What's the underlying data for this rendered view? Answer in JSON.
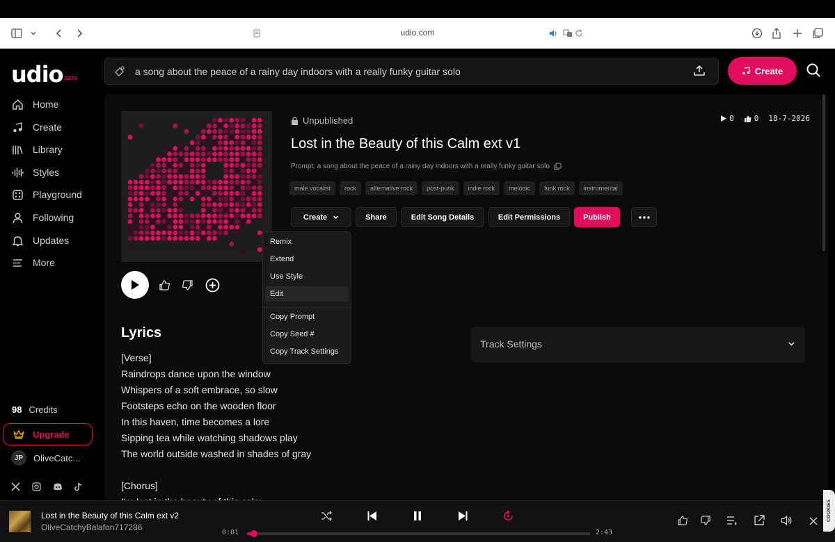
{
  "browser": {
    "url": "udio.com"
  },
  "brand": {
    "name": "udio",
    "badge": "BETA",
    "accent": "#e30b5c"
  },
  "search": {
    "value": "a song about the peace of a rainy day indoors with a really funky guitar solo"
  },
  "header": {
    "create_label": "Create"
  },
  "sidebar": {
    "items": [
      {
        "label": "Home",
        "icon": "home-icon"
      },
      {
        "label": "Create",
        "icon": "music-note-icon"
      },
      {
        "label": "Library",
        "icon": "library-icon"
      },
      {
        "label": "Styles",
        "icon": "waveform-icon"
      },
      {
        "label": "Playground",
        "icon": "playground-icon"
      },
      {
        "label": "Following",
        "icon": "user-icon"
      },
      {
        "label": "Updates",
        "icon": "bell-icon"
      },
      {
        "label": "More",
        "icon": "menu-icon"
      }
    ],
    "credits_count": "98",
    "credits_label": "Credits",
    "upgrade_label": "Upgrade",
    "user_initials": "JP",
    "user_name": "OliveCatc..."
  },
  "song": {
    "status": "Unpublished",
    "plays": "0",
    "likes": "0",
    "date": "18-7-2026",
    "title": "Lost in the Beauty of this Calm ext v1",
    "prompt": "Prompt: a song about the peace of a rainy day indoors with a really funky guitar solo",
    "tags": [
      "male vocalist",
      "rock",
      "alternative rock",
      "post-punk",
      "indie rock",
      "melodic",
      "funk rock",
      "instrumental"
    ]
  },
  "actions": {
    "create": "Create",
    "share": "Share",
    "edit_details": "Edit Song Details",
    "edit_permissions": "Edit Permissions",
    "publish": "Publish"
  },
  "dropdown": {
    "items": [
      "Remix",
      "Extend",
      "Use Style",
      "Edit",
      "Copy Prompt",
      "Copy Seed #",
      "Copy Track Settings"
    ]
  },
  "lyrics": {
    "heading": "Lyrics",
    "lines": [
      "[Verse]",
      "Raindrops dance upon the window",
      "Whispers of a soft embrace, so slow",
      "Footsteps echo on the wooden floor",
      "In this haven, time becomes a lore",
      "Sipping tea while watching shadows play",
      "The world outside washed in shades of gray",
      "",
      "[Chorus]",
      "I'm lost in the beauty of this calm"
    ]
  },
  "track_settings": {
    "label": "Track Settings"
  },
  "player": {
    "title": "Lost in the Beauty of this Calm ext v2",
    "artist": "OliveCatchyBalafon717286",
    "current_time": "0:01",
    "duration": "2:43",
    "progress": 0.01
  },
  "cookie_label": "COOKIES"
}
